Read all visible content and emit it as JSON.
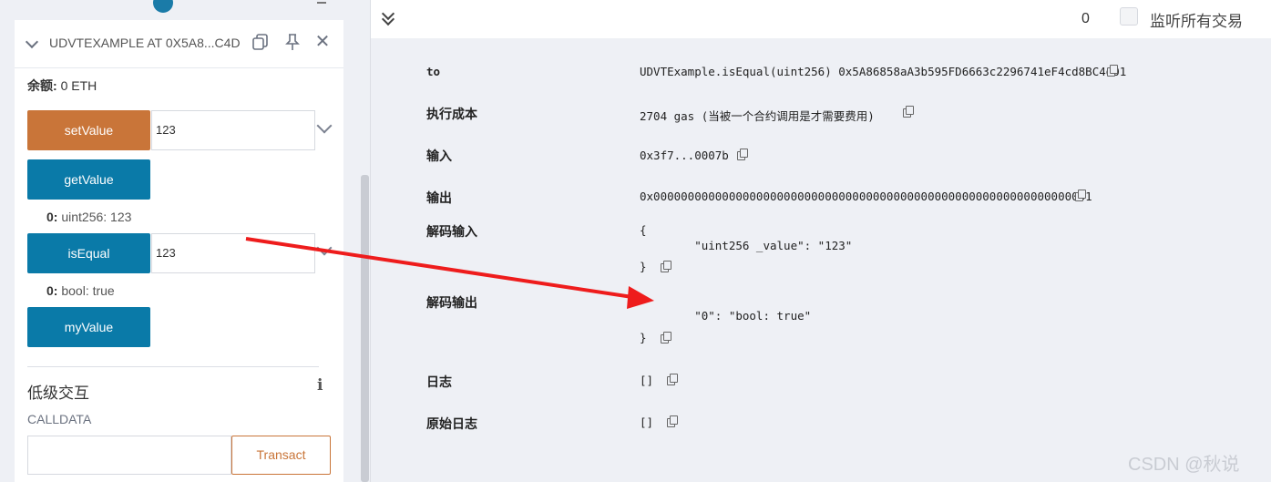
{
  "left_panel": {
    "header": {
      "contract_title": "UDVTEXAMPLE AT 0X5A8...C4D",
      "icons": [
        "chevron-down-icon",
        "copy-icon",
        "pin-icon",
        "close-icon"
      ]
    },
    "balance": {
      "label": "余额:",
      "value": "0 ETH"
    },
    "functions": [
      {
        "name": "setValue",
        "input": "123",
        "color": "#c97539"
      },
      {
        "name": "getValue"
      },
      {
        "name": "isEqual",
        "input": "123",
        "color": "#0a7aa8"
      },
      {
        "name": "myValue"
      }
    ],
    "results": {
      "getValue": {
        "key": "0:",
        "value": "uint256: 123"
      },
      "isEqual": {
        "key": "0:",
        "value": "bool: true"
      }
    },
    "low_level": {
      "title": "低级交互",
      "calldata_label": "CALLDATA",
      "transact_label": "Transact"
    }
  },
  "right_panel": {
    "toolbar": {
      "counter": "0",
      "listen_label": "监听所有交易"
    },
    "rows": [
      {
        "key": "to",
        "value": "UDVTExample.isEqual(uint256) 0x5A86858aA3b595FD6663c2296741eF4cd8BC4d01"
      },
      {
        "key": "执行成本",
        "value": "2704 gas (当被一个合约调用是才需要费用)"
      },
      {
        "key": "输入",
        "value": "0x3f7...0007b"
      },
      {
        "key": "输出",
        "value": "0x0000000000000000000000000000000000000000000000000000000000000001"
      },
      {
        "key": "解码输入",
        "value_lines": [
          "{",
          "        \"uint256 _value\": \"123\"",
          "}"
        ]
      },
      {
        "key": "解码输出",
        "value_lines": [
          "        \"0\": \"bool: true\"",
          "}"
        ]
      },
      {
        "key": "日志",
        "value": "[]"
      },
      {
        "key": "原始日志",
        "value": "[]"
      }
    ]
  },
  "watermark": "CSDN @秋说",
  "annotation": {
    "arrow_color": "#ee1c1c"
  }
}
